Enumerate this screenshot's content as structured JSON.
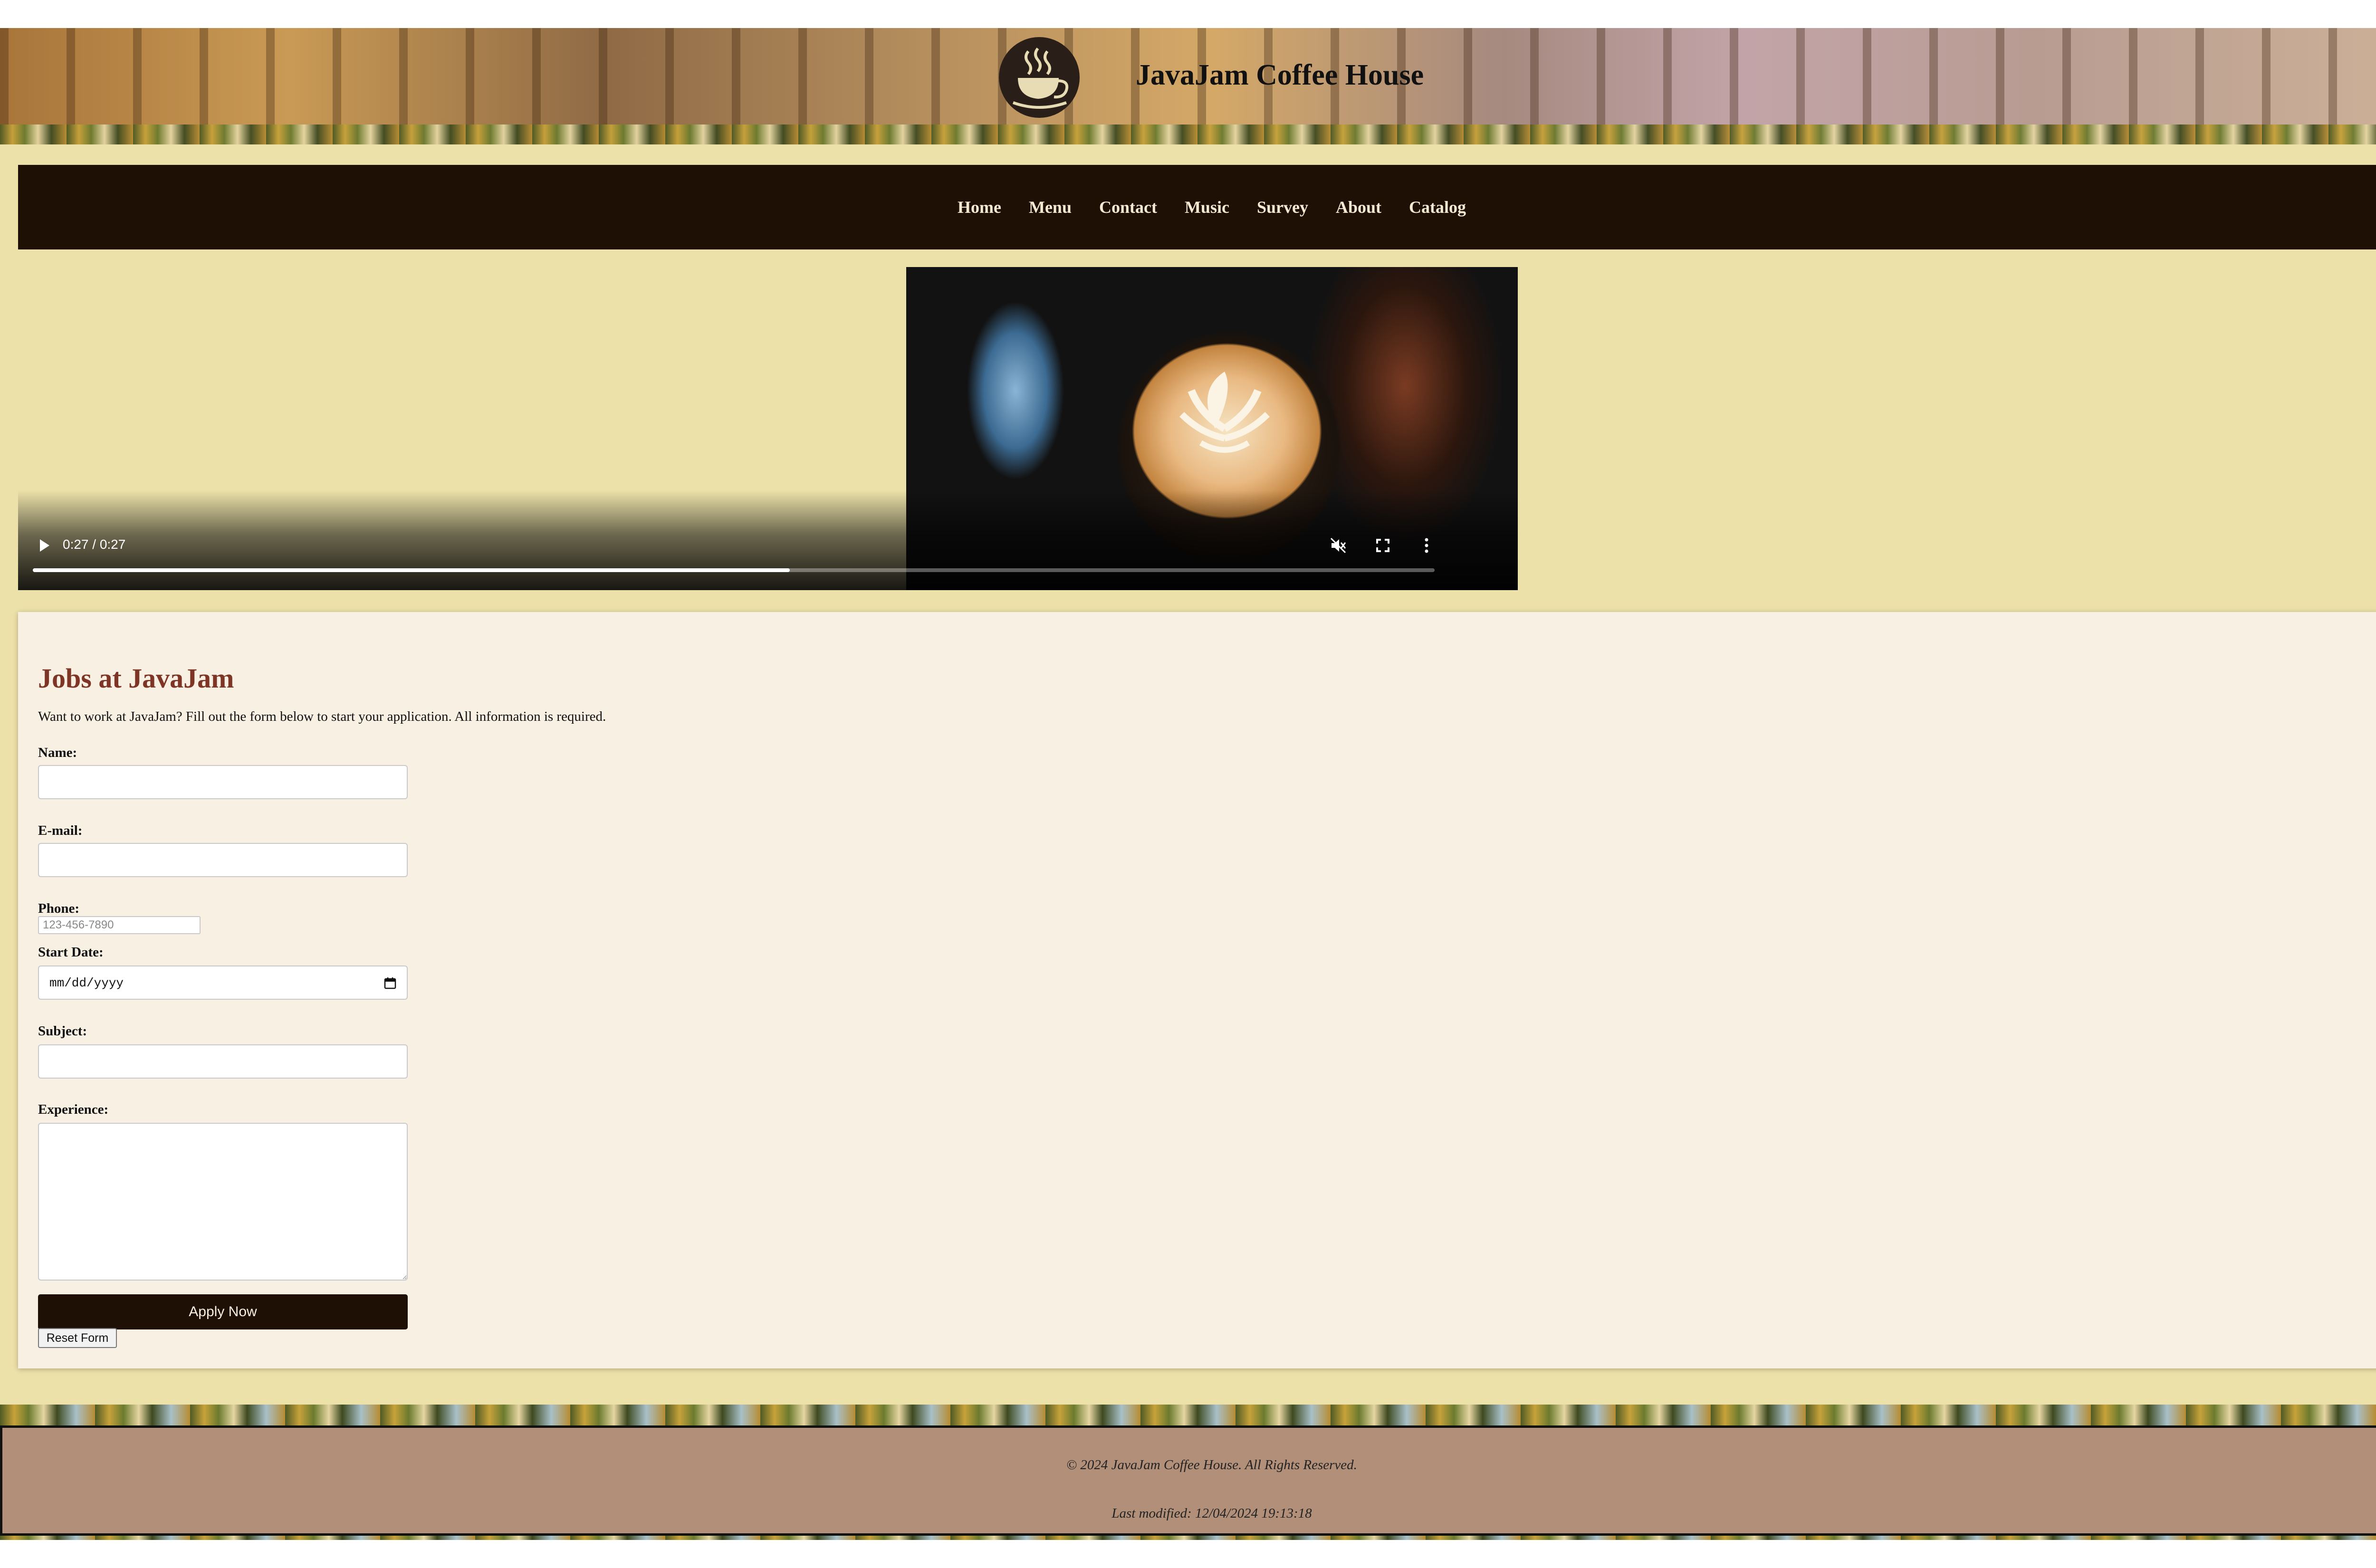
{
  "header": {
    "title": "JavaJam Coffee House",
    "logo_icon": "coffee-cup-icon"
  },
  "nav": {
    "items": [
      {
        "label": "Home"
      },
      {
        "label": "Menu"
      },
      {
        "label": "Contact"
      },
      {
        "label": "Music"
      },
      {
        "label": "Survey"
      },
      {
        "label": "About"
      },
      {
        "label": "Catalog"
      }
    ]
  },
  "video": {
    "time": "0:27 / 0:27",
    "progress_fraction": 0.54,
    "controls": {
      "play_icon": "play-icon",
      "mute_icon": "mute-icon",
      "fullscreen_icon": "fullscreen-icon",
      "more_icon": "more-options-icon"
    }
  },
  "jobs": {
    "heading": "Jobs at JavaJam",
    "intro": "Want to work at JavaJam? Fill out the form below to start your application. All information is required.",
    "fields": {
      "name": {
        "label": "Name:",
        "value": ""
      },
      "email": {
        "label": "E-mail:",
        "value": ""
      },
      "phone": {
        "label": "Phone:",
        "placeholder": "123-456-7890",
        "value": ""
      },
      "start_date": {
        "label": "Start Date:",
        "value": "mm/dd/yyyy"
      },
      "subject": {
        "label": "Subject:",
        "value": ""
      },
      "experience": {
        "label": "Experience:",
        "value": ""
      }
    },
    "apply_label": "Apply Now",
    "reset_label": "Reset Form"
  },
  "footer": {
    "copyright": "© 2024 JavaJam Coffee House. All Rights Reserved.",
    "last_modified": "Last modified: 12/04/2024 19:13:18"
  },
  "colors": {
    "nav_bg": "#1f1005",
    "page_bg": "#ece1a9",
    "card_bg": "#f7f0e3",
    "heading": "#7e3525",
    "footer_bg": "#b18f78"
  }
}
